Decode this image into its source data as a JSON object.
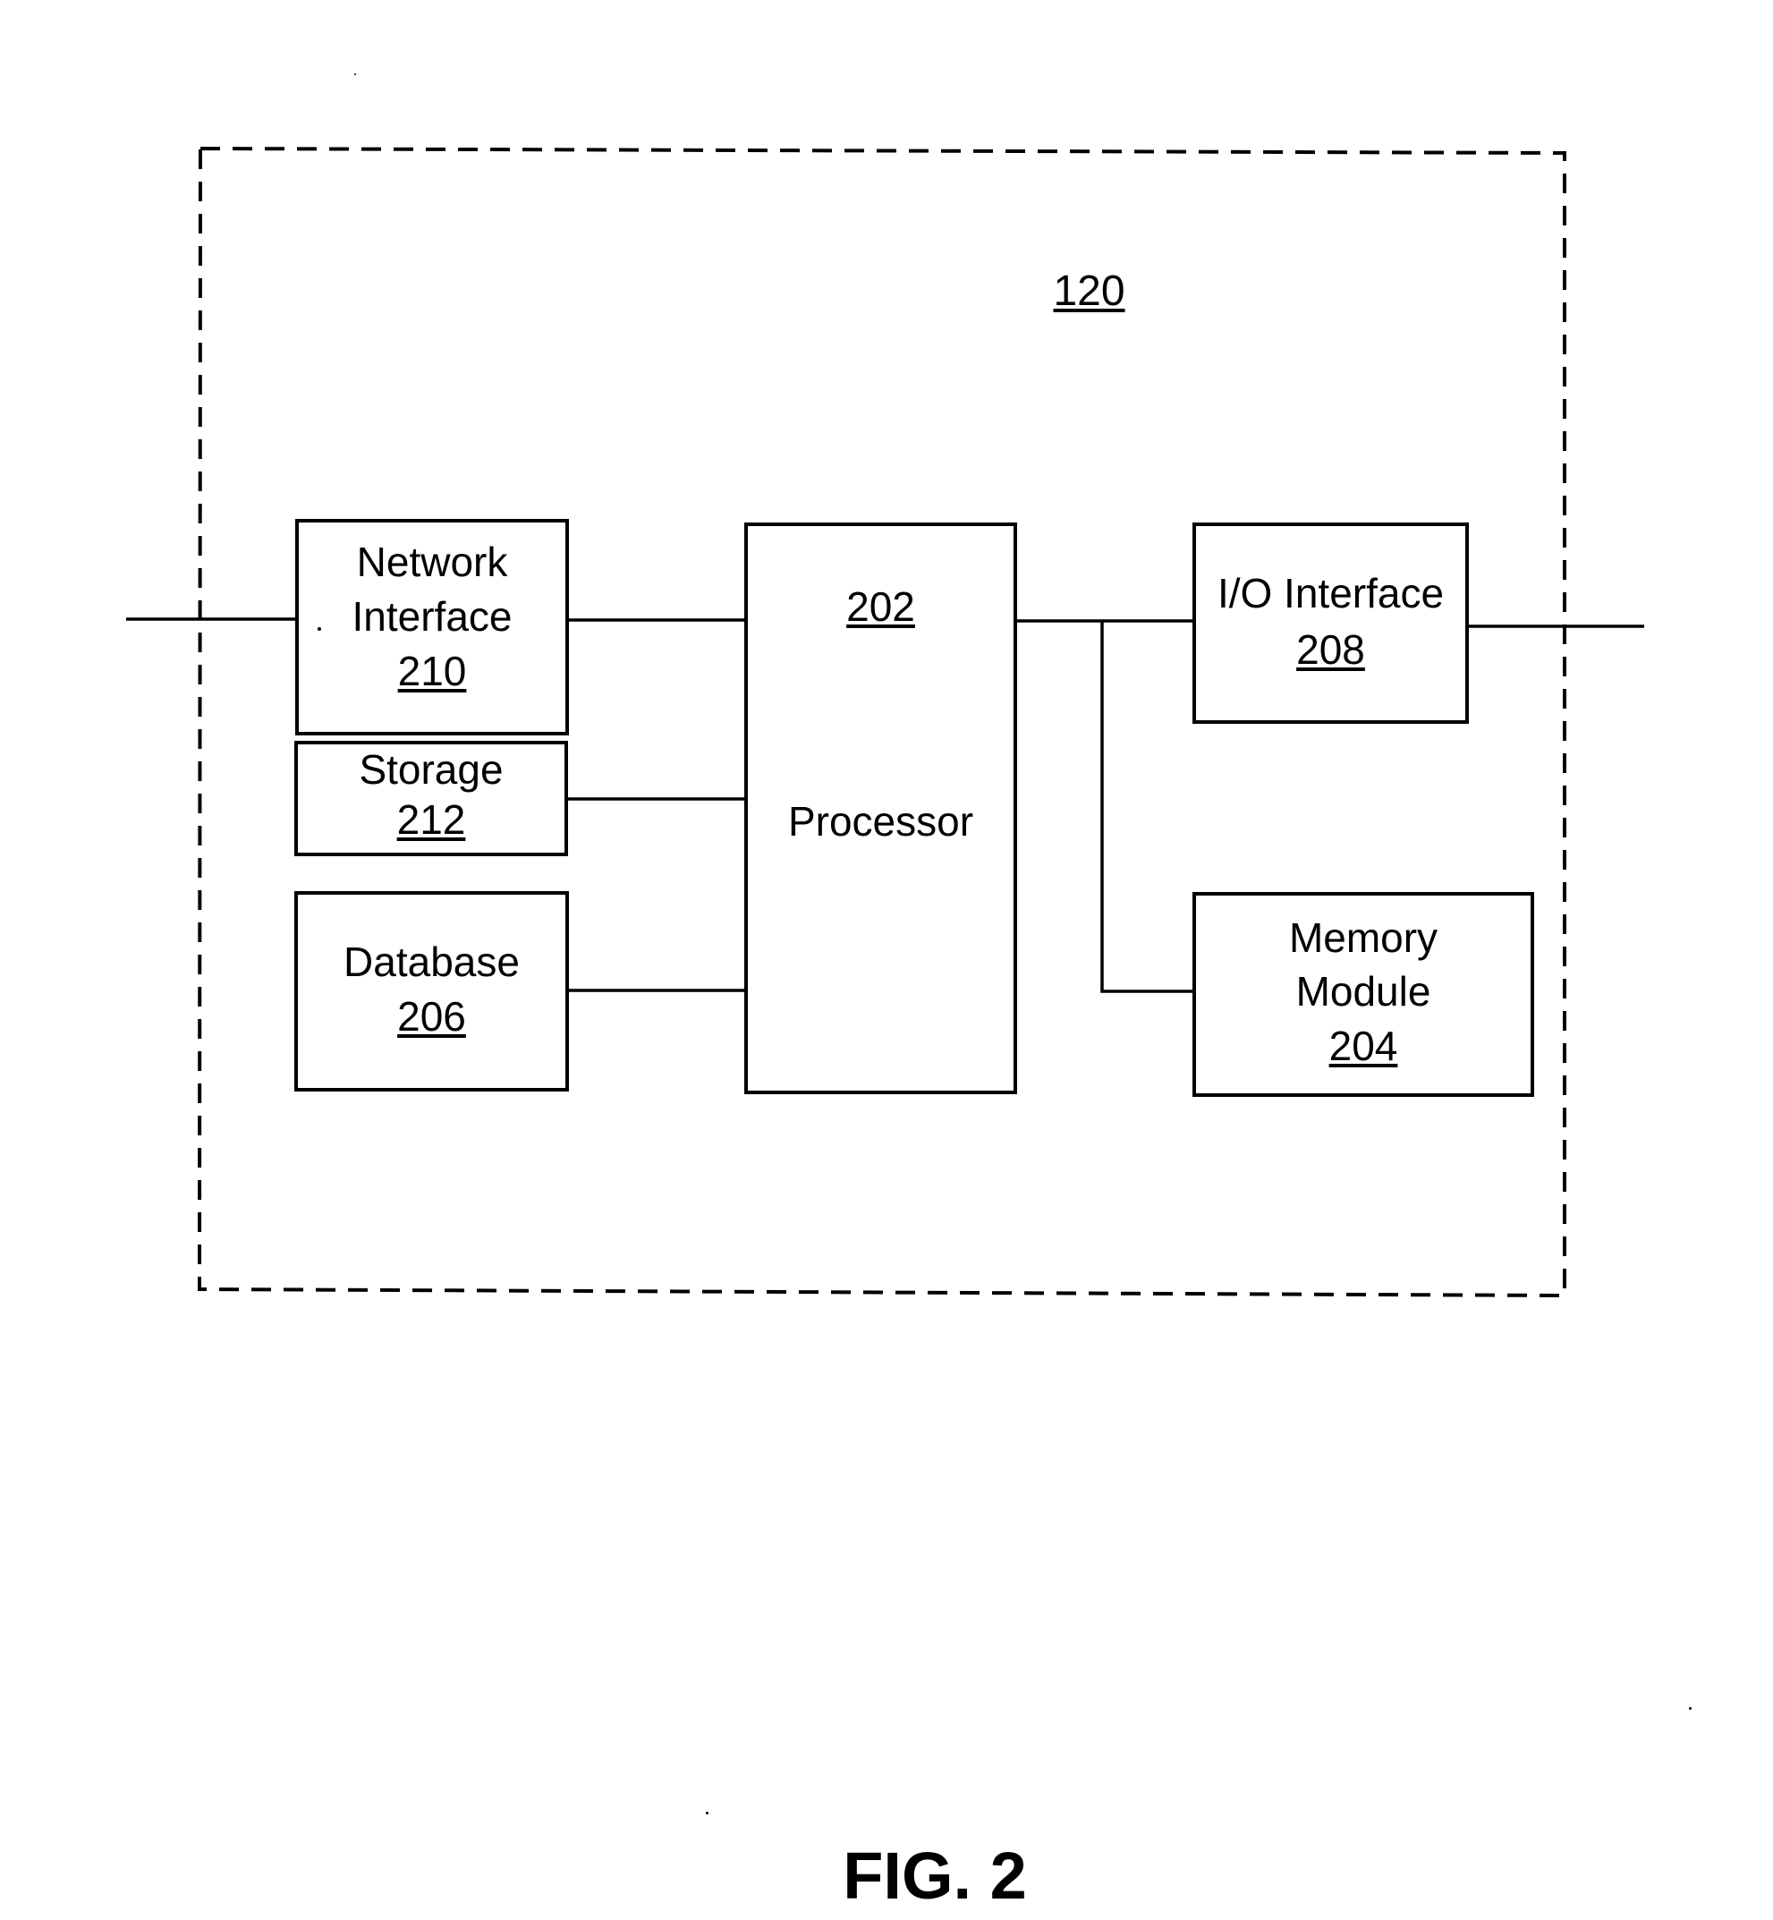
{
  "figure": {
    "caption": "FIG. 2",
    "system_ref": "120",
    "colors": {
      "ink": "#000000",
      "background": "#ffffff"
    }
  },
  "components": {
    "network_interface": {
      "lines": [
        "Network",
        "Interface"
      ],
      "ref": "210"
    },
    "storage": {
      "lines": [
        "Storage"
      ],
      "ref": "212"
    },
    "database": {
      "lines": [
        "Database"
      ],
      "ref": "206"
    },
    "processor": {
      "lines": [
        "Processor"
      ],
      "ref": "202"
    },
    "io_interface": {
      "lines": [
        "I/O Interface"
      ],
      "ref": "208"
    },
    "memory_module": {
      "lines": [
        "Memory",
        "Module"
      ],
      "ref": "204"
    }
  },
  "connections": [
    {
      "from": "external",
      "to": "network_interface"
    },
    {
      "from": "network_interface",
      "to": "processor"
    },
    {
      "from": "storage",
      "to": "processor"
    },
    {
      "from": "database",
      "to": "processor"
    },
    {
      "from": "processor",
      "to": "io_interface"
    },
    {
      "from": "processor",
      "to": "memory_module"
    },
    {
      "from": "io_interface",
      "to": "external"
    }
  ]
}
